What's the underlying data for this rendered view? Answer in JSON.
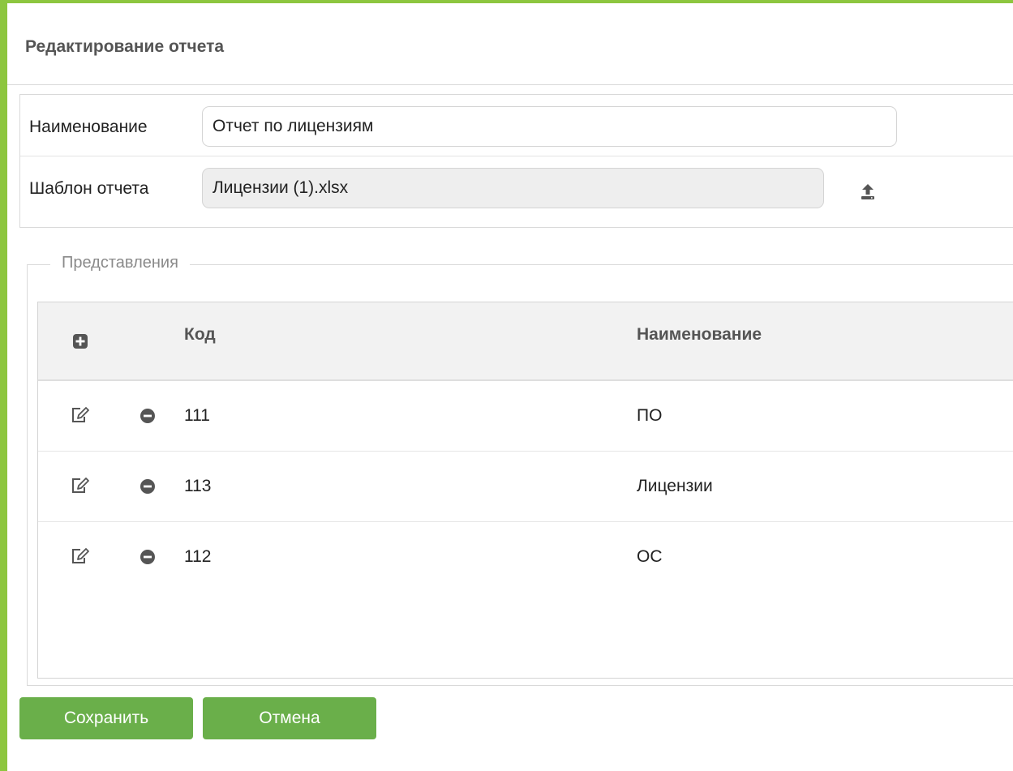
{
  "dialog": {
    "title": "Редактирование отчета"
  },
  "form": {
    "name_label": "Наименование",
    "name_value": "Отчет по лицензиям",
    "template_label": "Шаблон отчета",
    "template_value": "Лицензии (1).xlsx",
    "upload_icon": "upload-icon"
  },
  "views": {
    "legend": "Представления",
    "columns": {
      "add_icon": "plus-square-icon",
      "code": "Код",
      "name": "Наименование"
    },
    "rows": [
      {
        "code": "111",
        "name": "ПО"
      },
      {
        "code": "113",
        "name": "Лицензии"
      },
      {
        "code": "112",
        "name": "ОС"
      }
    ],
    "row_icons": {
      "edit": "edit-icon",
      "remove": "minus-circle-icon"
    }
  },
  "actions": {
    "save_label": "Сохранить",
    "cancel_label": "Отмена"
  },
  "colors": {
    "accent": "#8dc63f",
    "button": "#6aaf4a",
    "icon": "#555555"
  }
}
